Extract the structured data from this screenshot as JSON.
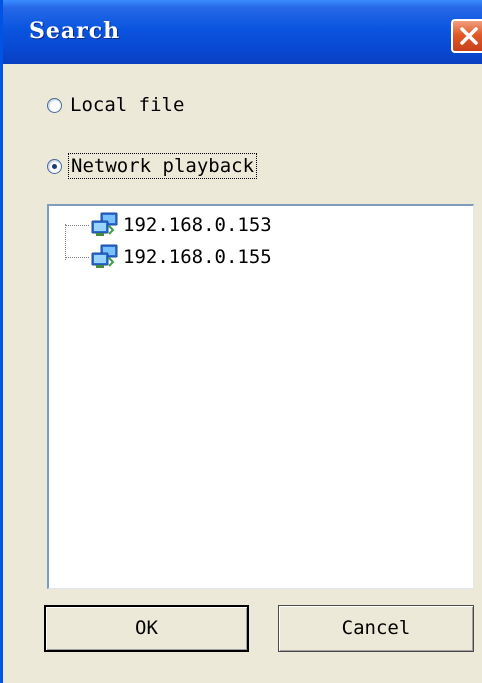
{
  "window": {
    "title": "Search"
  },
  "options": {
    "local_file_label": "Local file",
    "network_playback_label": "Network playback",
    "selected": "network_playback"
  },
  "tree": {
    "items": [
      {
        "label": "192.168.0.153",
        "icon": "network-computer-icon"
      },
      {
        "label": "192.168.0.155",
        "icon": "network-computer-icon"
      }
    ]
  },
  "buttons": {
    "ok_label": "OK",
    "cancel_label": "Cancel"
  },
  "colors": {
    "titlebar": "#0a55e0",
    "close": "#e15a2a",
    "dialog_bg": "#ece9d8"
  }
}
